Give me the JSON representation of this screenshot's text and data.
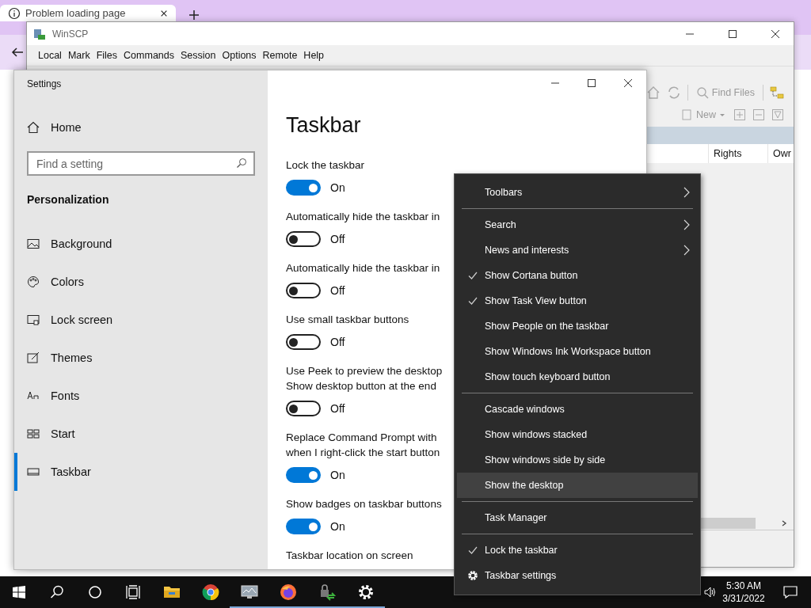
{
  "browser": {
    "tab_title": "Problem loading page"
  },
  "winscp": {
    "title": "WinSCP",
    "menu": [
      "Local",
      "Mark",
      "Files",
      "Commands",
      "Session",
      "Options",
      "Remote",
      "Help"
    ],
    "find_files": "Find Files",
    "new_label": "New",
    "columns": [
      "Rights",
      "Owr"
    ]
  },
  "settings": {
    "title": "Settings",
    "home": "Home",
    "search": {
      "placeholder": "Find a setting"
    },
    "section": "Personalization",
    "nav": [
      {
        "kind": "background",
        "label": "Background",
        "selected": false
      },
      {
        "kind": "colors",
        "label": "Colors",
        "selected": false
      },
      {
        "kind": "lockscreen",
        "label": "Lock screen",
        "selected": false
      },
      {
        "kind": "themes",
        "label": "Themes",
        "selected": false
      },
      {
        "kind": "fonts",
        "label": "Fonts",
        "selected": false
      },
      {
        "kind": "start",
        "label": "Start",
        "selected": false
      },
      {
        "kind": "taskbar",
        "label": "Taskbar",
        "selected": true
      }
    ],
    "page_title": "Taskbar",
    "options": [
      {
        "label": "Lock the taskbar",
        "on": true,
        "state": "On"
      },
      {
        "label": "Automatically hide the taskbar in",
        "on": false,
        "state": "Off"
      },
      {
        "label": "Automatically hide the taskbar in",
        "on": false,
        "state": "Off"
      },
      {
        "label": "Use small taskbar buttons",
        "on": false,
        "state": "Off"
      },
      {
        "label": "Use Peek to preview the desktop\nShow desktop button at the end",
        "on": false,
        "state": "Off"
      },
      {
        "label": "Replace Command Prompt with\nwhen I right-click the start button",
        "on": true,
        "state": "On"
      },
      {
        "label": "Show badges on taskbar buttons",
        "on": true,
        "state": "On"
      }
    ],
    "last_label": "Taskbar location on screen"
  },
  "context_menu": [
    {
      "kind": "item",
      "label": "Toolbars",
      "checked": false,
      "submenu": true,
      "selected": false
    },
    {
      "kind": "separator"
    },
    {
      "kind": "item",
      "label": "Search",
      "checked": false,
      "submenu": true,
      "selected": false
    },
    {
      "kind": "item",
      "label": "News and interests",
      "checked": false,
      "submenu": true,
      "selected": false
    },
    {
      "kind": "item",
      "label": "Show Cortana button",
      "checked": true,
      "submenu": false,
      "selected": false
    },
    {
      "kind": "item",
      "label": "Show Task View button",
      "checked": true,
      "submenu": false,
      "selected": false
    },
    {
      "kind": "item",
      "label": "Show People on the taskbar",
      "checked": false,
      "submenu": false,
      "selected": false
    },
    {
      "kind": "item",
      "label": "Show Windows Ink Workspace button",
      "checked": false,
      "submenu": false,
      "selected": false
    },
    {
      "kind": "item",
      "label": "Show touch keyboard button",
      "checked": false,
      "submenu": false,
      "selected": false
    },
    {
      "kind": "separator"
    },
    {
      "kind": "item",
      "label": "Cascade windows",
      "checked": false,
      "submenu": false,
      "selected": false
    },
    {
      "kind": "item",
      "label": "Show windows stacked",
      "checked": false,
      "submenu": false,
      "selected": false
    },
    {
      "kind": "item",
      "label": "Show windows side by side",
      "checked": false,
      "submenu": false,
      "selected": false
    },
    {
      "kind": "item",
      "label": "Show the desktop",
      "checked": false,
      "submenu": false,
      "selected": true
    },
    {
      "kind": "separator"
    },
    {
      "kind": "item",
      "label": "Task Manager",
      "checked": false,
      "submenu": false,
      "selected": false
    },
    {
      "kind": "separator"
    },
    {
      "kind": "item",
      "label": "Lock the taskbar",
      "checked": true,
      "submenu": false,
      "selected": false
    },
    {
      "kind": "gear",
      "label": "Taskbar settings",
      "checked": false,
      "submenu": false,
      "selected": false
    }
  ],
  "taskbar": {
    "apps": [
      {
        "kind": "folder",
        "running": false
      },
      {
        "kind": "chrome",
        "running": false
      },
      {
        "kind": "monitor",
        "running": true
      },
      {
        "kind": "firefox",
        "running": true
      },
      {
        "kind": "transfer",
        "running": true
      },
      {
        "kind": "gear",
        "running": true
      }
    ],
    "time": "5:30 AM",
    "date": "3/31/2022"
  }
}
